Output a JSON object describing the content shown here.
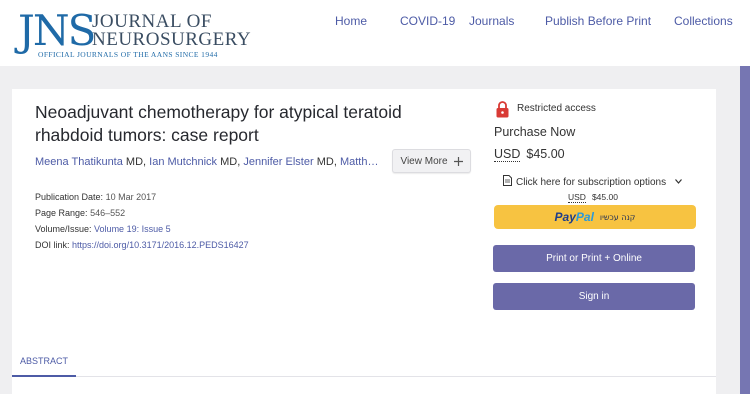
{
  "logo": {
    "mark": "JNS",
    "line1": "JOURNAL OF",
    "line2": "NEUROSURGERY",
    "tagline": "OFFICIAL JOURNALS OF THE AANS SINCE 1944"
  },
  "nav": [
    "Home",
    "COVID-19",
    "Journals",
    "Publish Before Print",
    "Collections"
  ],
  "article": {
    "title": "Neoadjuvant chemotherapy for atypical teratoid rhabdoid tumors: case report",
    "authors": [
      {
        "name": "Meena Thatikunta",
        "degree": "MD"
      },
      {
        "name": "Ian Mutchnick",
        "degree": "MD"
      },
      {
        "name": "Jennifer Elster",
        "degree": "MD"
      },
      {
        "name": "Matth…",
        "degree": ""
      }
    ],
    "view_more": "View More",
    "meta": {
      "pub_label": "Publication Date:",
      "pub_value": "10 Mar 2017",
      "range_label": "Page Range:",
      "range_value": "546–552",
      "vol_label": "Volume/Issue:",
      "vol_value": "Volume 19: Issue 5",
      "doi_label": "DOI link:",
      "doi_value": "https://doi.org/10.3171/2016.12.PEDS16427"
    }
  },
  "purchase": {
    "access": "Restricted access",
    "heading": "Purchase Now",
    "currency": "USD",
    "price": "$45.00",
    "subscription": "Click here for subscription options",
    "paypal_brand_a": "Pay",
    "paypal_brand_b": "Pal",
    "paypal_hebrew": "קנה עכשיו",
    "print_button": "Print or Print + Online",
    "signin_button": "Sign in"
  },
  "tabs": [
    "ABSTRACT"
  ],
  "colors": {
    "accent": "#4d5ba6",
    "button": "#6a69a8",
    "paypal": "#f7c341",
    "logo_blue": "#1f6aa7"
  }
}
